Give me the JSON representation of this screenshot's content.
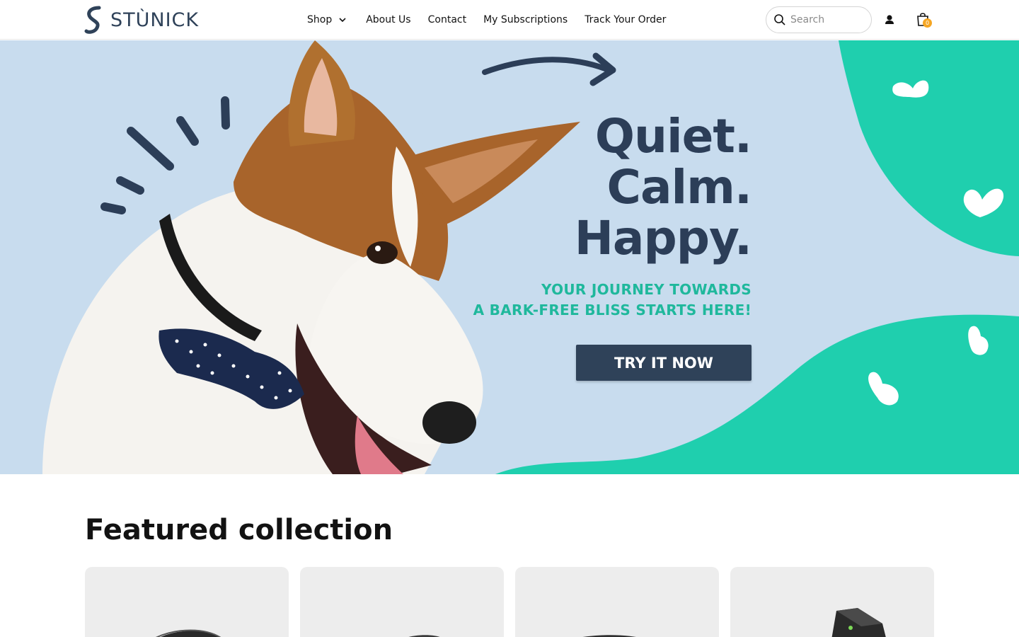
{
  "header": {
    "brand": "STÙNICK",
    "nav": [
      {
        "label": "Shop",
        "has_dropdown": true
      },
      {
        "label": "About Us"
      },
      {
        "label": "Contact"
      },
      {
        "label": "My Subscriptions"
      },
      {
        "label": "Track Your Order"
      }
    ],
    "search_placeholder": "Search",
    "cart_count": "0"
  },
  "hero": {
    "headline_lines": [
      "Quiet.",
      "Calm.",
      "Happy."
    ],
    "subline_lines": [
      "YOUR JOURNEY TOWARDS",
      "A BARK-FREE BLISS STARTS HERE!"
    ],
    "cta_label": "TRY IT NOW"
  },
  "featured": {
    "title": "Featured collection",
    "products": [
      {
        "icon": "bark-collar-device-image"
      },
      {
        "icon": "bark-collar-device-image"
      },
      {
        "icon": "bark-collar-device-image"
      },
      {
        "icon": "ultrasonic-device-image"
      }
    ]
  },
  "colors": {
    "brand_navy": "#2f4259",
    "accent_teal": "#1fcfae",
    "hero_bg": "#c8dcee",
    "cart_badge": "#f5a623"
  }
}
